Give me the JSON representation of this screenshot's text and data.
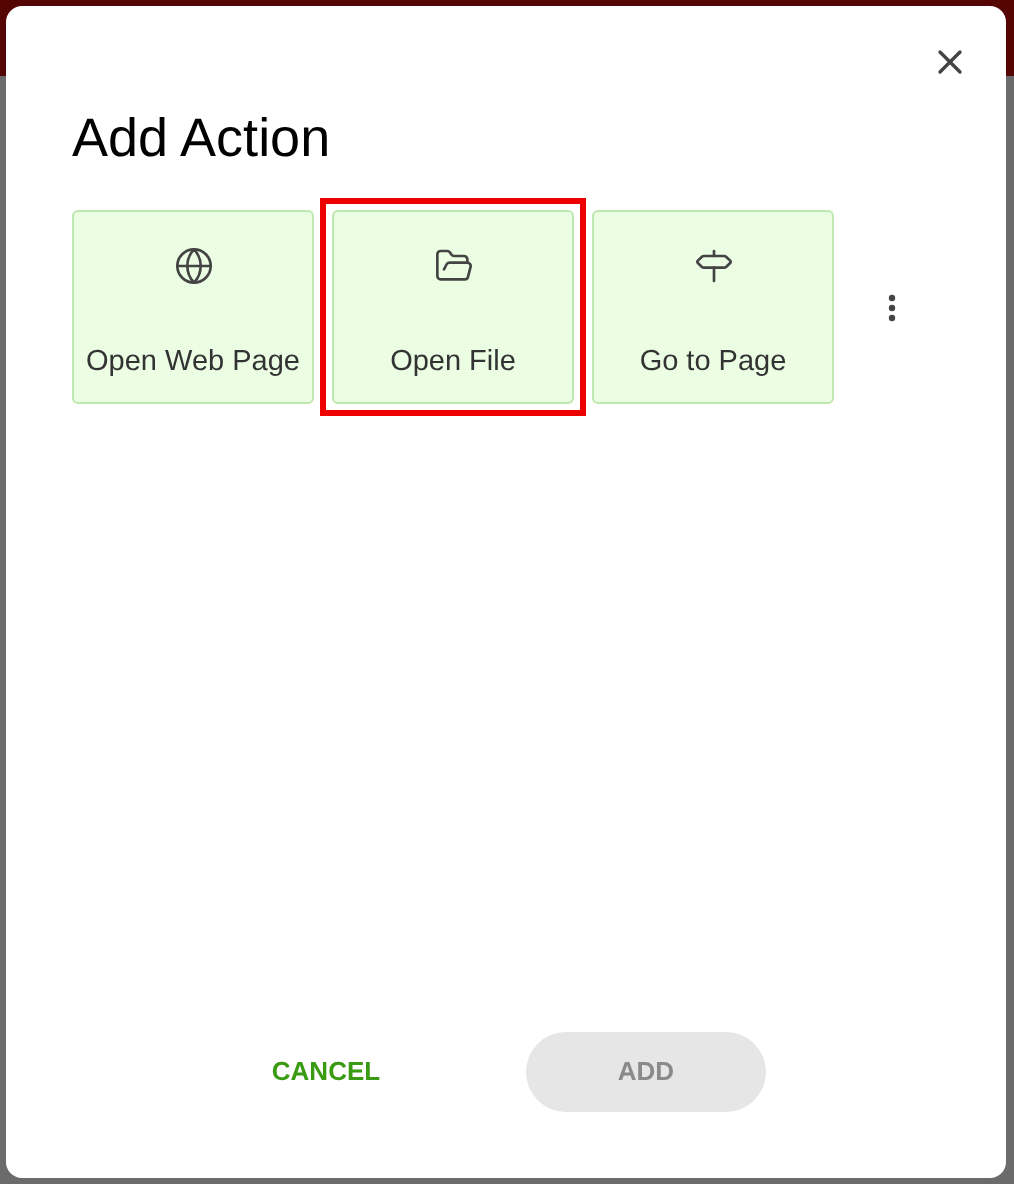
{
  "dialog": {
    "title": "Add Action",
    "actions": [
      {
        "kind": "web",
        "label": "Open Web Page",
        "highlighted": false
      },
      {
        "kind": "file",
        "label": "Open File",
        "highlighted": true
      },
      {
        "kind": "page",
        "label": "Go to Page",
        "highlighted": false
      }
    ],
    "buttons": [
      {
        "kind": "cancel",
        "label": "CANCEL",
        "disabled": false
      },
      {
        "kind": "add",
        "label": "ADD",
        "disabled": true
      }
    ]
  }
}
